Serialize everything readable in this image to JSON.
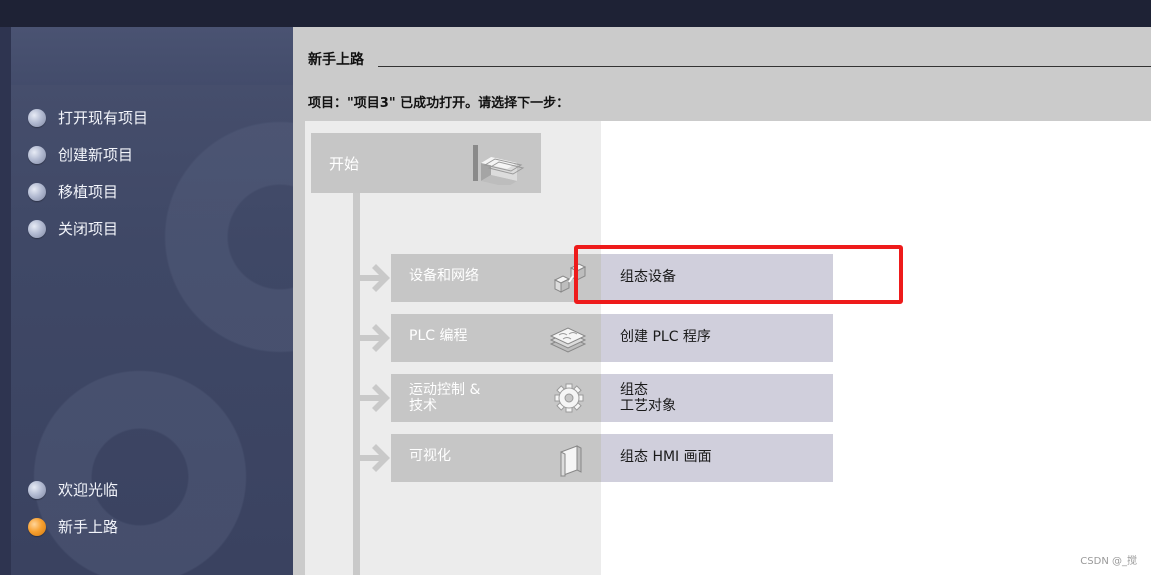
{
  "sidebar": {
    "menu": [
      {
        "label": "打开现有项目",
        "active": false
      },
      {
        "label": "创建新项目",
        "active": false
      },
      {
        "label": "移植项目",
        "active": false
      },
      {
        "label": "关闭项目",
        "active": false
      }
    ],
    "bottom": [
      {
        "label": "欢迎光临",
        "active": false
      },
      {
        "label": "新手上路",
        "active": true
      }
    ]
  },
  "main": {
    "section_title": "新手上路",
    "status": "项目：\"项目3\" 已成功打开。请选择下一步：",
    "start": {
      "label": "开始",
      "icon": "stairs-icon"
    },
    "categories": [
      {
        "label": "设备和网络",
        "icon": "network-devices-icon"
      },
      {
        "label": "PLC 编程",
        "icon": "puzzle-stack-icon"
      },
      {
        "label": "运动控制 &\n技术",
        "icon": "gear-icon"
      },
      {
        "label": "可视化",
        "icon": "hmi-panel-icon"
      }
    ],
    "actions": [
      {
        "label": "组态设备"
      },
      {
        "label": "创建 PLC 程序"
      },
      {
        "label": "组态\n工艺对象"
      },
      {
        "label": "组态 HMI 画面"
      }
    ]
  },
  "colors": {
    "highlight": "#ee1b1b",
    "active_bullet": "#f7a030",
    "action_bg": "#d0cfdc",
    "category_bg": "#c6c6c6"
  },
  "watermark": "CSDN @_搅"
}
